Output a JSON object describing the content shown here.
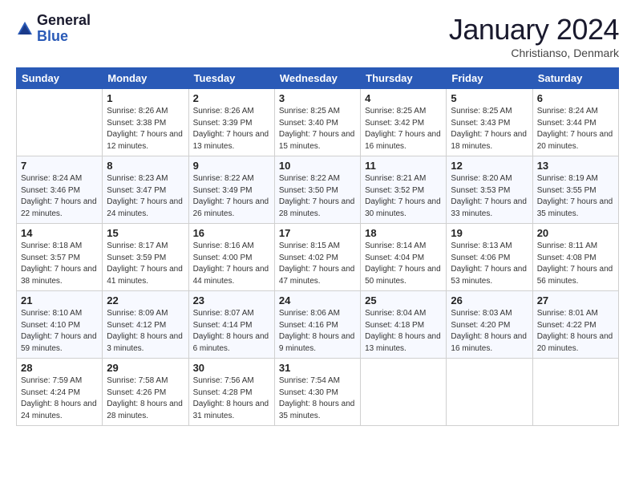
{
  "header": {
    "logo": {
      "line1": "General",
      "line2": "Blue"
    },
    "title": "January 2024",
    "subtitle": "Christianso, Denmark"
  },
  "weekdays": [
    "Sunday",
    "Monday",
    "Tuesday",
    "Wednesday",
    "Thursday",
    "Friday",
    "Saturday"
  ],
  "weeks": [
    [
      {
        "day": "",
        "sunrise": "",
        "sunset": "",
        "daylight": ""
      },
      {
        "day": "1",
        "sunrise": "Sunrise: 8:26 AM",
        "sunset": "Sunset: 3:38 PM",
        "daylight": "Daylight: 7 hours and 12 minutes."
      },
      {
        "day": "2",
        "sunrise": "Sunrise: 8:26 AM",
        "sunset": "Sunset: 3:39 PM",
        "daylight": "Daylight: 7 hours and 13 minutes."
      },
      {
        "day": "3",
        "sunrise": "Sunrise: 8:25 AM",
        "sunset": "Sunset: 3:40 PM",
        "daylight": "Daylight: 7 hours and 15 minutes."
      },
      {
        "day": "4",
        "sunrise": "Sunrise: 8:25 AM",
        "sunset": "Sunset: 3:42 PM",
        "daylight": "Daylight: 7 hours and 16 minutes."
      },
      {
        "day": "5",
        "sunrise": "Sunrise: 8:25 AM",
        "sunset": "Sunset: 3:43 PM",
        "daylight": "Daylight: 7 hours and 18 minutes."
      },
      {
        "day": "6",
        "sunrise": "Sunrise: 8:24 AM",
        "sunset": "Sunset: 3:44 PM",
        "daylight": "Daylight: 7 hours and 20 minutes."
      }
    ],
    [
      {
        "day": "7",
        "sunrise": "Sunrise: 8:24 AM",
        "sunset": "Sunset: 3:46 PM",
        "daylight": "Daylight: 7 hours and 22 minutes."
      },
      {
        "day": "8",
        "sunrise": "Sunrise: 8:23 AM",
        "sunset": "Sunset: 3:47 PM",
        "daylight": "Daylight: 7 hours and 24 minutes."
      },
      {
        "day": "9",
        "sunrise": "Sunrise: 8:22 AM",
        "sunset": "Sunset: 3:49 PM",
        "daylight": "Daylight: 7 hours and 26 minutes."
      },
      {
        "day": "10",
        "sunrise": "Sunrise: 8:22 AM",
        "sunset": "Sunset: 3:50 PM",
        "daylight": "Daylight: 7 hours and 28 minutes."
      },
      {
        "day": "11",
        "sunrise": "Sunrise: 8:21 AM",
        "sunset": "Sunset: 3:52 PM",
        "daylight": "Daylight: 7 hours and 30 minutes."
      },
      {
        "day": "12",
        "sunrise": "Sunrise: 8:20 AM",
        "sunset": "Sunset: 3:53 PM",
        "daylight": "Daylight: 7 hours and 33 minutes."
      },
      {
        "day": "13",
        "sunrise": "Sunrise: 8:19 AM",
        "sunset": "Sunset: 3:55 PM",
        "daylight": "Daylight: 7 hours and 35 minutes."
      }
    ],
    [
      {
        "day": "14",
        "sunrise": "Sunrise: 8:18 AM",
        "sunset": "Sunset: 3:57 PM",
        "daylight": "Daylight: 7 hours and 38 minutes."
      },
      {
        "day": "15",
        "sunrise": "Sunrise: 8:17 AM",
        "sunset": "Sunset: 3:59 PM",
        "daylight": "Daylight: 7 hours and 41 minutes."
      },
      {
        "day": "16",
        "sunrise": "Sunrise: 8:16 AM",
        "sunset": "Sunset: 4:00 PM",
        "daylight": "Daylight: 7 hours and 44 minutes."
      },
      {
        "day": "17",
        "sunrise": "Sunrise: 8:15 AM",
        "sunset": "Sunset: 4:02 PM",
        "daylight": "Daylight: 7 hours and 47 minutes."
      },
      {
        "day": "18",
        "sunrise": "Sunrise: 8:14 AM",
        "sunset": "Sunset: 4:04 PM",
        "daylight": "Daylight: 7 hours and 50 minutes."
      },
      {
        "day": "19",
        "sunrise": "Sunrise: 8:13 AM",
        "sunset": "Sunset: 4:06 PM",
        "daylight": "Daylight: 7 hours and 53 minutes."
      },
      {
        "day": "20",
        "sunrise": "Sunrise: 8:11 AM",
        "sunset": "Sunset: 4:08 PM",
        "daylight": "Daylight: 7 hours and 56 minutes."
      }
    ],
    [
      {
        "day": "21",
        "sunrise": "Sunrise: 8:10 AM",
        "sunset": "Sunset: 4:10 PM",
        "daylight": "Daylight: 7 hours and 59 minutes."
      },
      {
        "day": "22",
        "sunrise": "Sunrise: 8:09 AM",
        "sunset": "Sunset: 4:12 PM",
        "daylight": "Daylight: 8 hours and 3 minutes."
      },
      {
        "day": "23",
        "sunrise": "Sunrise: 8:07 AM",
        "sunset": "Sunset: 4:14 PM",
        "daylight": "Daylight: 8 hours and 6 minutes."
      },
      {
        "day": "24",
        "sunrise": "Sunrise: 8:06 AM",
        "sunset": "Sunset: 4:16 PM",
        "daylight": "Daylight: 8 hours and 9 minutes."
      },
      {
        "day": "25",
        "sunrise": "Sunrise: 8:04 AM",
        "sunset": "Sunset: 4:18 PM",
        "daylight": "Daylight: 8 hours and 13 minutes."
      },
      {
        "day": "26",
        "sunrise": "Sunrise: 8:03 AM",
        "sunset": "Sunset: 4:20 PM",
        "daylight": "Daylight: 8 hours and 16 minutes."
      },
      {
        "day": "27",
        "sunrise": "Sunrise: 8:01 AM",
        "sunset": "Sunset: 4:22 PM",
        "daylight": "Daylight: 8 hours and 20 minutes."
      }
    ],
    [
      {
        "day": "28",
        "sunrise": "Sunrise: 7:59 AM",
        "sunset": "Sunset: 4:24 PM",
        "daylight": "Daylight: 8 hours and 24 minutes."
      },
      {
        "day": "29",
        "sunrise": "Sunrise: 7:58 AM",
        "sunset": "Sunset: 4:26 PM",
        "daylight": "Daylight: 8 hours and 28 minutes."
      },
      {
        "day": "30",
        "sunrise": "Sunrise: 7:56 AM",
        "sunset": "Sunset: 4:28 PM",
        "daylight": "Daylight: 8 hours and 31 minutes."
      },
      {
        "day": "31",
        "sunrise": "Sunrise: 7:54 AM",
        "sunset": "Sunset: 4:30 PM",
        "daylight": "Daylight: 8 hours and 35 minutes."
      },
      {
        "day": "",
        "sunrise": "",
        "sunset": "",
        "daylight": ""
      },
      {
        "day": "",
        "sunrise": "",
        "sunset": "",
        "daylight": ""
      },
      {
        "day": "",
        "sunrise": "",
        "sunset": "",
        "daylight": ""
      }
    ]
  ]
}
